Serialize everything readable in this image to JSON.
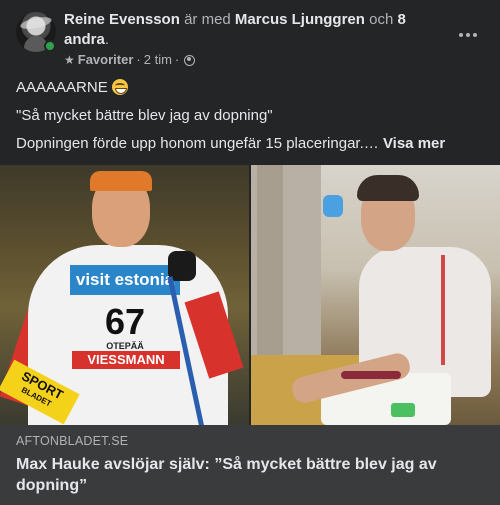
{
  "header": {
    "author": "Reine Evensson",
    "with_text": "är med",
    "tagged": "Marcus Ljunggren",
    "and_text": "och",
    "others": "8 andra",
    "period": ".",
    "audience_label": "Favoriter",
    "separator": "·",
    "time": "2 tim",
    "separator2": "·",
    "star_icon": "star-icon",
    "privacy_icon": "globe-icon",
    "more_icon": "more-options-icon"
  },
  "post": {
    "line1": "AAAAAARNE",
    "line1_emoji": "grinning-face-emoji",
    "line2": "\"Så mycket bättre blev jag av dopning\"",
    "line3": "Dopningen förde upp honom ungefär 15 placeringar.…",
    "see_more": "Visa mer"
  },
  "images": {
    "left_bib_sponsor_top": "visit estonia",
    "left_bib_number": "67",
    "left_bib_city": "OTEPÄÄ",
    "left_bib_sponsor_bottom": "VIESSMANN",
    "left_logo_line1": "SPORT",
    "left_logo_line2": "BLADET"
  },
  "link_preview": {
    "domain": "AFTONBLADET.SE",
    "title": "Max Hauke avslöjar själv: ”Så mycket bättre blev jag av dopning”"
  },
  "colors": {
    "background": "#242526",
    "text_primary": "#e4e6eb",
    "text_secondary": "#b0b3b8",
    "link_box": "#3a3b3c",
    "online": "#31a24c"
  }
}
